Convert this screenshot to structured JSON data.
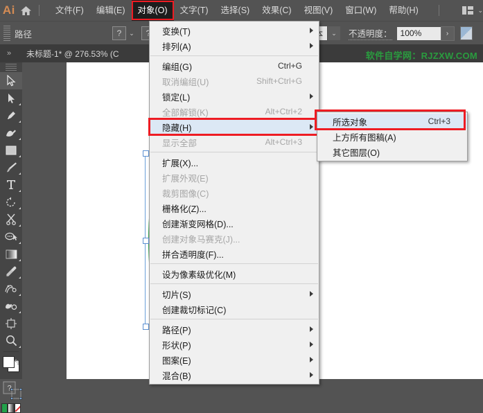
{
  "app": {
    "logo_text": "Ai",
    "home_icon": "home-icon",
    "arrange_icon": "arrange-documents-icon",
    "arrange_caret": "⌄"
  },
  "menubar": {
    "items": [
      {
        "label": "文件(F)",
        "active": false
      },
      {
        "label": "编辑(E)",
        "active": false
      },
      {
        "label": "对象(O)",
        "active": true
      },
      {
        "label": "文字(T)",
        "active": false
      },
      {
        "label": "选择(S)",
        "active": false
      },
      {
        "label": "效果(C)",
        "active": false
      },
      {
        "label": "视图(V)",
        "active": false
      },
      {
        "label": "窗口(W)",
        "active": false
      },
      {
        "label": "帮助(H)",
        "active": false
      }
    ]
  },
  "optionsbar": {
    "label": "路径",
    "fill_swatch": "?",
    "stroke_swatch": "?",
    "stroke_profile": "基本",
    "opacity_label": "不透明度：",
    "opacity_value": "100%",
    "opacity_more": "›",
    "caret": "⌄"
  },
  "tabbar": {
    "collapse_icon": "expand-panels-icon",
    "doc_title": "未标题-1* @ 276.53% (C",
    "watermark": "软件自学网：RJZXW.COM"
  },
  "toolbar": {
    "tools": [
      {
        "name": "selection-tool",
        "selected": true,
        "sub": false
      },
      {
        "name": "direct-selection-tool",
        "selected": false,
        "sub": true
      },
      {
        "name": "pen-tool",
        "selected": false,
        "sub": true
      },
      {
        "name": "curvature-tool",
        "selected": false,
        "sub": true
      },
      {
        "name": "rectangle-tool",
        "selected": false,
        "sub": true
      },
      {
        "name": "paintbrush-tool",
        "selected": false,
        "sub": true
      },
      {
        "name": "type-tool",
        "selected": false,
        "sub": true
      },
      {
        "name": "rotate-tool",
        "selected": false,
        "sub": true
      },
      {
        "name": "scissors-tool",
        "selected": false,
        "sub": true
      },
      {
        "name": "shape-builder-tool",
        "selected": false,
        "sub": true
      },
      {
        "name": "gradient-tool",
        "selected": false,
        "sub": true
      },
      {
        "name": "eyedropper-tool",
        "selected": false,
        "sub": true
      },
      {
        "name": "blend-tool",
        "selected": false,
        "sub": true
      },
      {
        "name": "symbol-sprayer-tool",
        "selected": false,
        "sub": true
      },
      {
        "name": "artboard-tool",
        "selected": false,
        "sub": false
      },
      {
        "name": "zoom-tool",
        "selected": false,
        "sub": true
      }
    ],
    "fill_stroke_icon": "fill-and-stroke-swatches",
    "swap_icon": "swap-fill-stroke-icon",
    "color_swatch_question": "?"
  },
  "menu": {
    "title": "对象(O)",
    "items": [
      {
        "label": "变换(T)",
        "shortcut": "",
        "disabled": false,
        "submenu": true,
        "highlight": false
      },
      {
        "label": "排列(A)",
        "shortcut": "",
        "disabled": false,
        "submenu": true,
        "highlight": false
      },
      {
        "type": "separator"
      },
      {
        "label": "编组(G)",
        "shortcut": "Ctrl+G",
        "disabled": false,
        "submenu": false,
        "highlight": false
      },
      {
        "label": "取消编组(U)",
        "shortcut": "Shift+Ctrl+G",
        "disabled": true,
        "submenu": false,
        "highlight": false
      },
      {
        "label": "锁定(L)",
        "shortcut": "",
        "disabled": false,
        "submenu": true,
        "highlight": false
      },
      {
        "label": "全部解锁(K)",
        "shortcut": "Alt+Ctrl+2",
        "disabled": true,
        "submenu": false,
        "highlight": false
      },
      {
        "label": "隐藏(H)",
        "shortcut": "",
        "disabled": false,
        "submenu": true,
        "highlight": true
      },
      {
        "label": "显示全部",
        "shortcut": "Alt+Ctrl+3",
        "disabled": true,
        "submenu": false,
        "highlight": false
      },
      {
        "type": "separator"
      },
      {
        "label": "扩展(X)...",
        "shortcut": "",
        "disabled": false,
        "submenu": false,
        "highlight": false
      },
      {
        "label": "扩展外观(E)",
        "shortcut": "",
        "disabled": true,
        "submenu": false,
        "highlight": false
      },
      {
        "label": "裁剪图像(C)",
        "shortcut": "",
        "disabled": true,
        "submenu": false,
        "highlight": false
      },
      {
        "label": "栅格化(Z)...",
        "shortcut": "",
        "disabled": false,
        "submenu": false,
        "highlight": false
      },
      {
        "label": "创建渐变网格(D)...",
        "shortcut": "",
        "disabled": false,
        "submenu": false,
        "highlight": false
      },
      {
        "label": "创建对象马赛克(J)...",
        "shortcut": "",
        "disabled": true,
        "submenu": false,
        "highlight": false
      },
      {
        "label": "拼合透明度(F)...",
        "shortcut": "",
        "disabled": false,
        "submenu": false,
        "highlight": false
      },
      {
        "type": "separator"
      },
      {
        "label": "设为像素级优化(M)",
        "shortcut": "",
        "disabled": false,
        "submenu": false,
        "highlight": false
      },
      {
        "type": "separator"
      },
      {
        "label": "切片(S)",
        "shortcut": "",
        "disabled": false,
        "submenu": true,
        "highlight": false
      },
      {
        "label": "创建裁切标记(C)",
        "shortcut": "",
        "disabled": false,
        "submenu": false,
        "highlight": false
      },
      {
        "type": "separator"
      },
      {
        "label": "路径(P)",
        "shortcut": "",
        "disabled": false,
        "submenu": true,
        "highlight": false
      },
      {
        "label": "形状(P)",
        "shortcut": "",
        "disabled": false,
        "submenu": true,
        "highlight": false
      },
      {
        "label": "图案(E)",
        "shortcut": "",
        "disabled": false,
        "submenu": true,
        "highlight": false
      },
      {
        "label": "混合(B)",
        "shortcut": "",
        "disabled": false,
        "submenu": true,
        "highlight": false
      }
    ]
  },
  "submenu": {
    "parent": "隐藏(H)",
    "items": [
      {
        "label": "所选对象",
        "shortcut": "Ctrl+3",
        "highlight": true
      },
      {
        "label": "上方所有图稿(A)",
        "shortcut": "",
        "highlight": false
      },
      {
        "label": "其它图层(O)",
        "shortcut": "",
        "highlight": false
      }
    ]
  },
  "canvas": {
    "shape_name": "green-ellipse",
    "shape_color": "#29a043",
    "selection_color": "#6a9fd8"
  },
  "colors": {
    "chrome": "#535353",
    "panel": "#454545",
    "menu_bg": "#f0f0f0",
    "highlight_red": "#ee1c23",
    "accent_green": "#2a9c3f",
    "menu_highlight": "#dce8f5"
  }
}
